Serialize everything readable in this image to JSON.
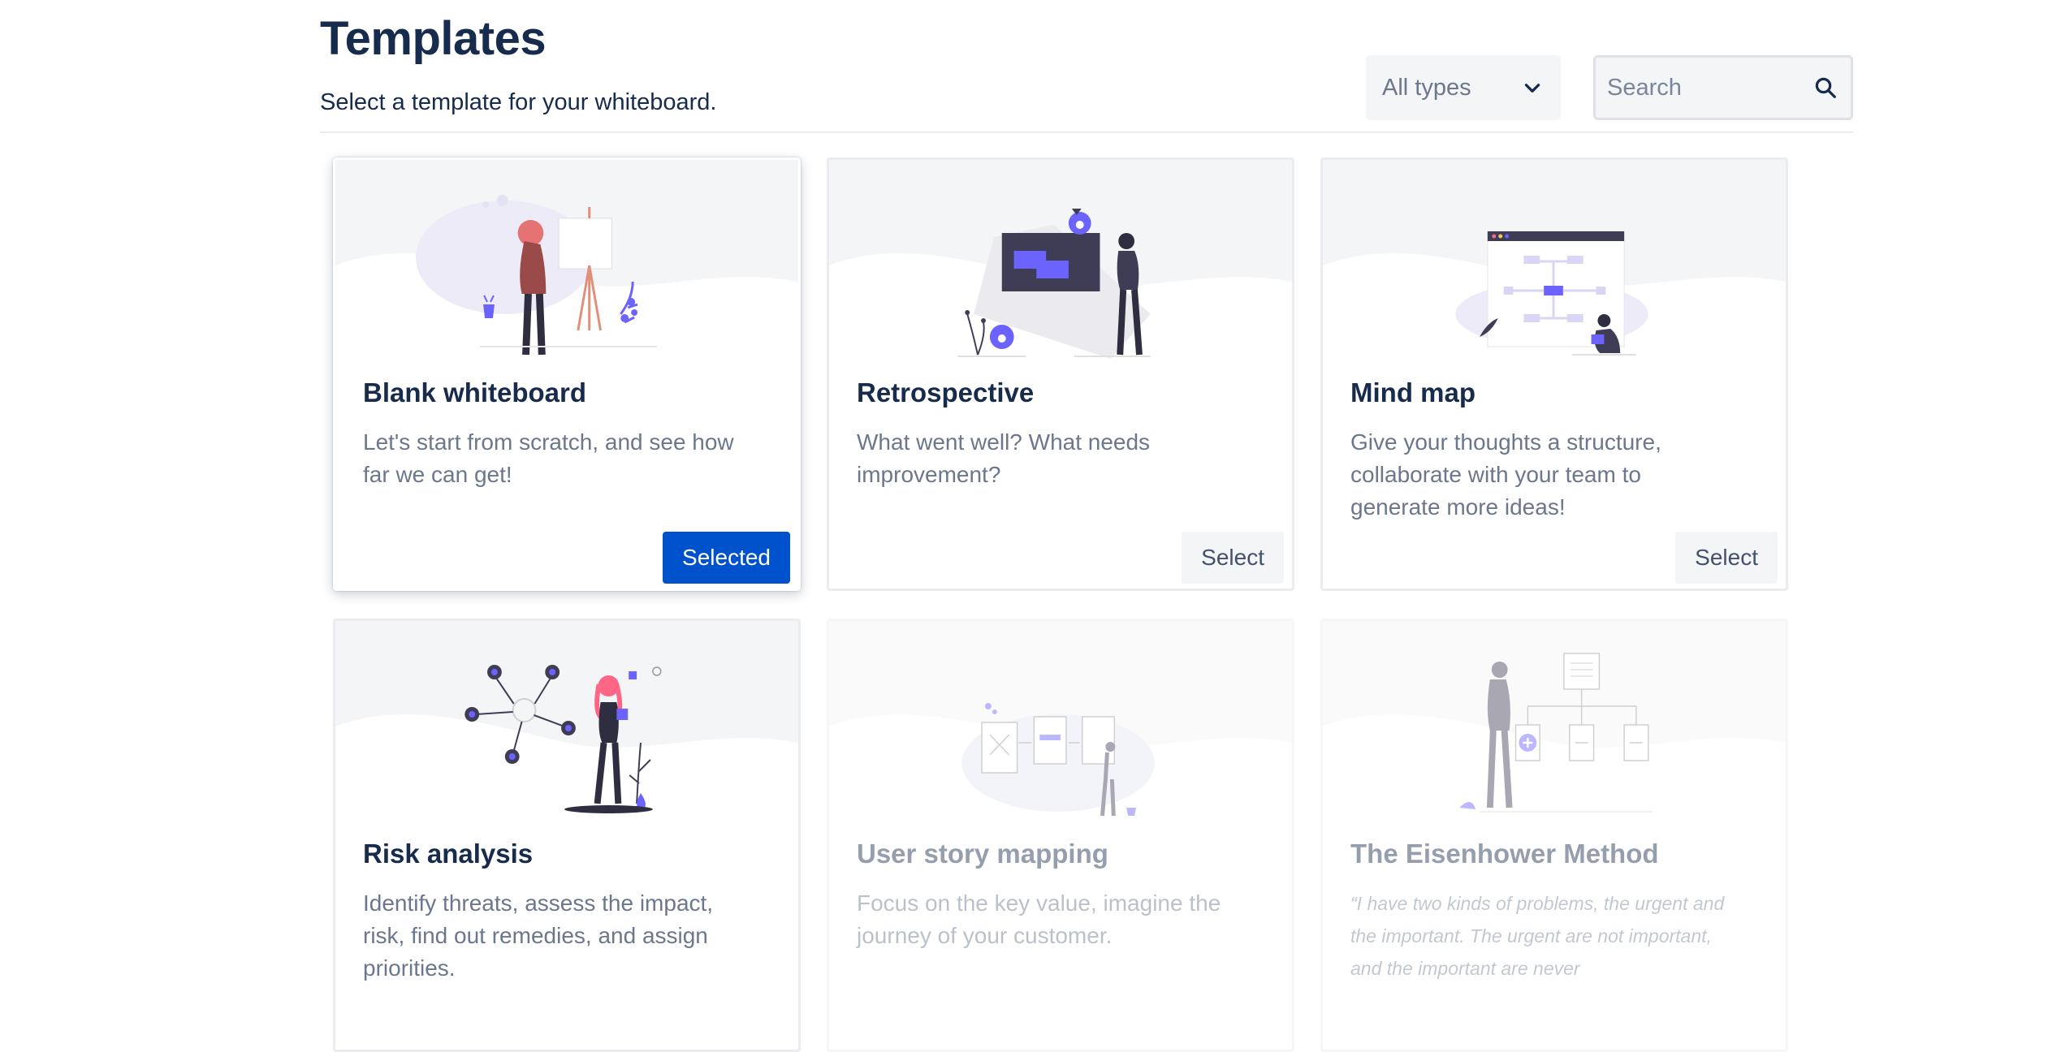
{
  "header": {
    "title": "Templates",
    "subtitle": "Select a template for your whiteboard."
  },
  "filter": {
    "selected": "All types",
    "icon": "chevron-down-icon"
  },
  "search": {
    "placeholder": "Search",
    "value": "",
    "icon": "search-icon"
  },
  "colors": {
    "primary": "#0052cc",
    "heading": "#172b4d",
    "muted": "#6b778c",
    "accent": "#6c63ff"
  },
  "cards": [
    {
      "title": "Blank whiteboard",
      "description": "Let's start from scratch, and see how far we can get!",
      "button": "Selected",
      "state": "selected",
      "illustration": "woman-at-easel-illustration"
    },
    {
      "title": "Retrospective",
      "description": "What went well? What needs improvement?",
      "button": "Select",
      "state": "default",
      "illustration": "man-at-board-illustration"
    },
    {
      "title": "Mind map",
      "description": "Give your thoughts a structure, collaborate with your team to generate more ideas!",
      "button": "Select",
      "state": "default",
      "illustration": "mind-map-browser-illustration"
    },
    {
      "title": "Risk analysis",
      "description": "Identify threats, assess the impact, risk, find out remedies, and assign priorities.",
      "button": "",
      "state": "default",
      "illustration": "woman-with-nodes-illustration"
    },
    {
      "title": "User story mapping",
      "description": "Focus on the key value, imagine the journey of your customer.",
      "button": "",
      "state": "disabled",
      "illustration": "story-cards-illustration"
    },
    {
      "title": "The Eisenhower Method",
      "description": "“I have two kinds of problems, the urgent and the important. The urgent are not important, and the important are never",
      "button": "",
      "state": "disabled",
      "illustration": "man-with-flowchart-illustration"
    }
  ]
}
